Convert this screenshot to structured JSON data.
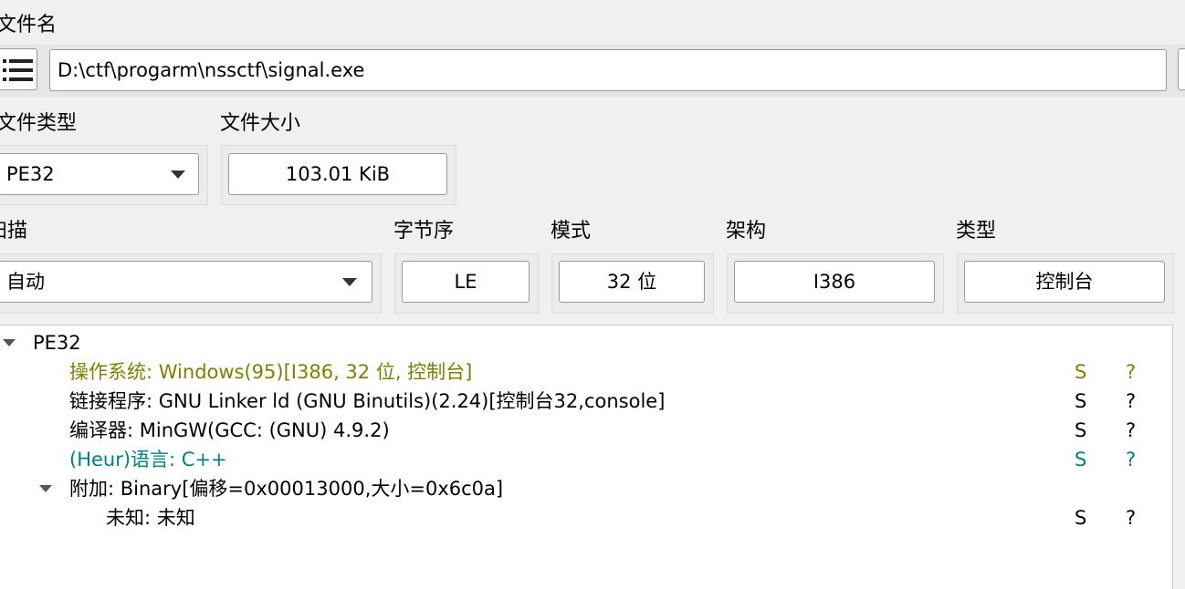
{
  "file_name": {
    "label": "文件名",
    "path": "D:\\ctf\\progarm\\nssctf\\signal.exe"
  },
  "file_type": {
    "label": "文件类型",
    "value": "PE32"
  },
  "file_size": {
    "label": "文件大小",
    "value": "103.01 KiB"
  },
  "scan": {
    "label": "扫描",
    "label_visible": "扫描",
    "value": "自动"
  },
  "endian": {
    "label": "字节序",
    "value": "LE"
  },
  "mode": {
    "label": "模式",
    "value": "32 位"
  },
  "arch": {
    "label": "架构",
    "value": "I386"
  },
  "type": {
    "label": "类型",
    "value": "控制台"
  },
  "colors": {
    "os": "#808000",
    "heur": "#008080",
    "normal": "#000000"
  },
  "tree": {
    "root": "PE32",
    "rows": [
      {
        "text": "操作系统: Windows(95)[I386, 32 位, 控制台]",
        "s": "S",
        "q": "?",
        "color": "#808000"
      },
      {
        "text": "链接程序: GNU Linker ld (GNU Binutils)(2.24)[控制台32,console]",
        "s": "S",
        "q": "?",
        "color": "#000000"
      },
      {
        "text": "编译器: MinGW(GCC: (GNU) 4.9.2)",
        "s": "S",
        "q": "?",
        "color": "#000000"
      },
      {
        "text": "(Heur)语言: C++",
        "s": "S",
        "q": "?",
        "color": "#008080"
      }
    ],
    "overlay": {
      "text": "附加: Binary[偏移=0x00013000,大小=0x6c0a]",
      "child": {
        "text": "未知: 未知",
        "s": "S",
        "q": "?"
      }
    }
  }
}
